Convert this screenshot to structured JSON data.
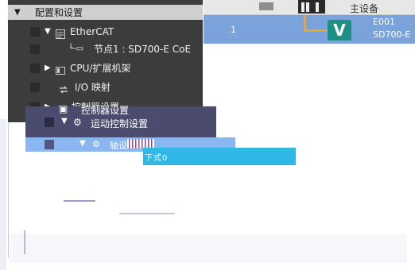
{
  "tree": {
    "header": {
      "label": "配置和设置",
      "toggle": "▼"
    },
    "items": [
      {
        "label": "EtherCAT",
        "toggle": "▼",
        "icon": "ethercat-icon",
        "indent": 1
      },
      {
        "label": "节点1 : SD700-E CoE",
        "toggle": "└-▭",
        "icon": "node-icon",
        "indent": 2
      },
      {
        "label": "CPU/扩展机架",
        "toggle": "▶",
        "icon": "rack-icon",
        "indent": 1
      },
      {
        "label": "I/O 映射",
        "toggle": "",
        "icon": "io-map-icon",
        "indent": 1
      },
      {
        "label": "控制器设置",
        "toggle": "▶",
        "icon": "controller-icon",
        "indent": 1
      }
    ],
    "motion": {
      "label": "运动控制设置",
      "toggle": "▼",
      "icon": "gear-icon",
      "overlay_label": "控制器设置"
    },
    "axis": {
      "label": "轴设",
      "toggle": "▼",
      "icon": "gear-icon"
    },
    "edit_text": "下式0"
  },
  "grid": {
    "header_label": "主设备",
    "row": {
      "index": "1",
      "badge_letter": "V",
      "device_id": "E001",
      "device_model": "SD700-E"
    }
  },
  "colors": {
    "tree_bg": "#3c3c3c",
    "tree_header_bg": "#cfcfcf",
    "grid_selected": "#7aa3dc",
    "connector": "#e8a33c",
    "badge": "#1f8f86",
    "motion_row": "#4b4b6e",
    "axis_row": "#8ab6f2",
    "edit_box": "#2fb7e6"
  }
}
